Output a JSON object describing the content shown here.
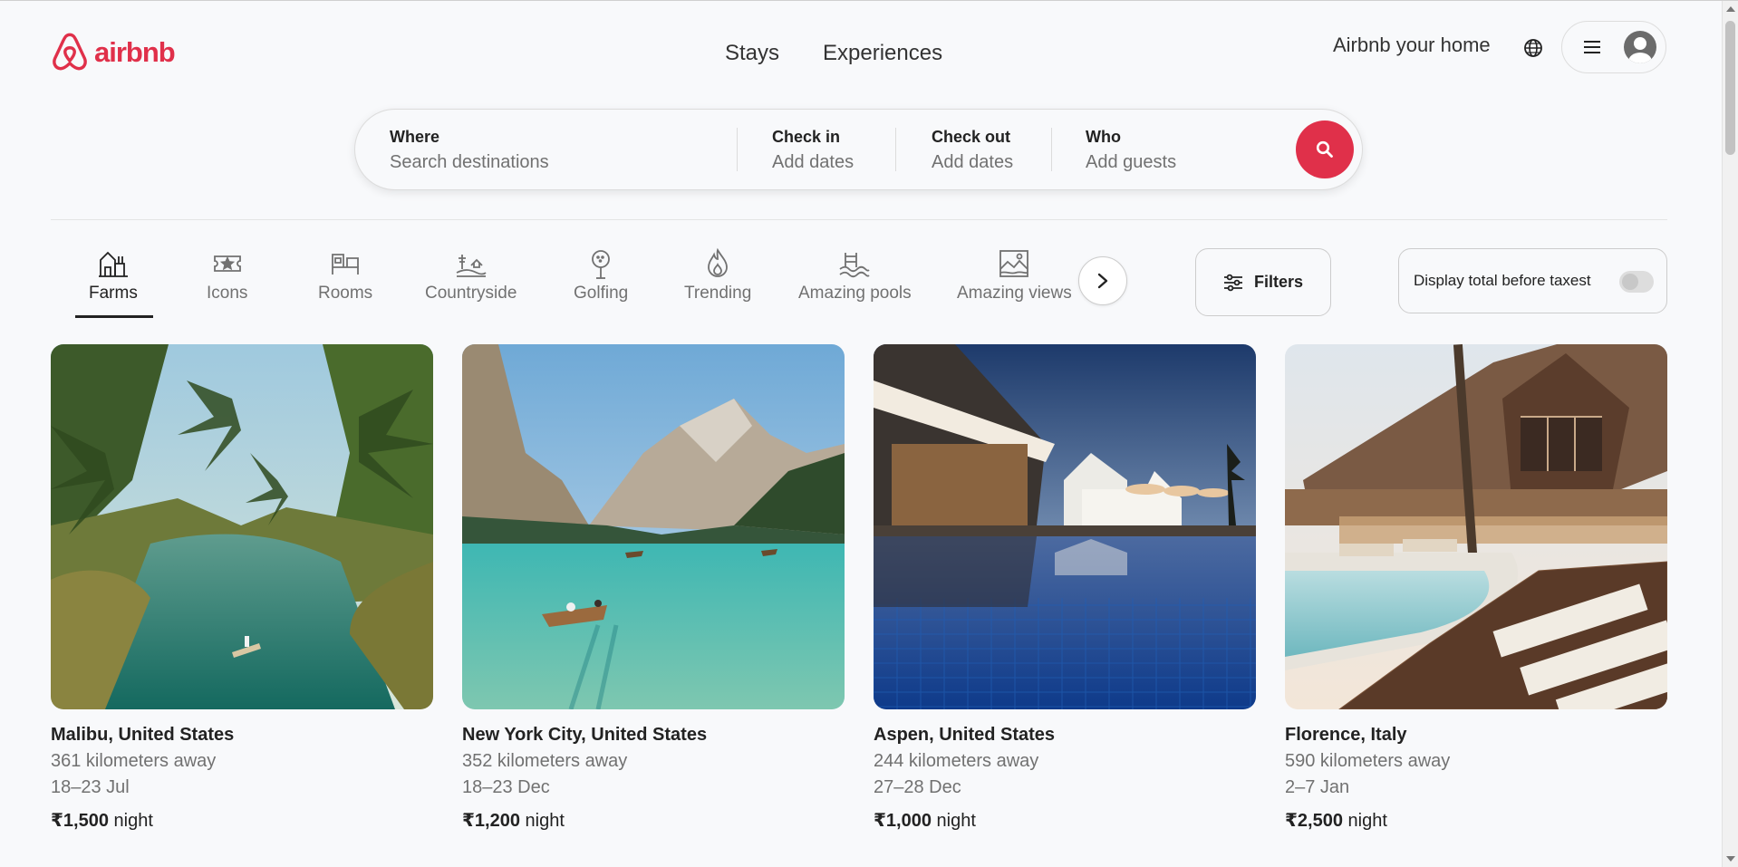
{
  "brand": {
    "name": "airbnb",
    "color": "#e0304a"
  },
  "nav": {
    "stays": "Stays",
    "experiences": "Experiences"
  },
  "header": {
    "host_link": "Airbnb your home",
    "globe_icon": "globe-icon",
    "menu_icon": "menu-icon",
    "avatar_icon": "user-avatar-icon"
  },
  "search": {
    "where_label": "Where",
    "where_placeholder": "Search destinations",
    "checkin_label": "Check in",
    "checkin_value": "Add dates",
    "checkout_label": "Check out",
    "checkout_value": "Add dates",
    "who_label": "Who",
    "who_value": "Add guests",
    "button_icon": "search-icon"
  },
  "categories": [
    {
      "label": "Farms",
      "icon": "farms-icon",
      "active": true
    },
    {
      "label": "Icons",
      "icon": "icons-icon",
      "active": false
    },
    {
      "label": "Rooms",
      "icon": "rooms-icon",
      "active": false
    },
    {
      "label": "Countryside",
      "icon": "countryside-icon",
      "active": false
    },
    {
      "label": "Golfing",
      "icon": "golfing-icon",
      "active": false
    },
    {
      "label": "Trending",
      "icon": "trending-icon",
      "active": false
    },
    {
      "label": "Amazing pools",
      "icon": "amazing-pools-icon",
      "active": false
    },
    {
      "label": "Amazing views",
      "icon": "amazing-views-icon",
      "active": false
    }
  ],
  "filters": {
    "label": "Filters",
    "taxes_label": "Display total before taxest",
    "taxes_toggle_on": false
  },
  "listings": [
    {
      "location": "Malibu, United States",
      "distance": "361 kilometers away",
      "dates": "18–23 Jul",
      "price": "₹1,500",
      "unit": "night",
      "image": "tropical river with palm trees and canoe"
    },
    {
      "location": "New York City, United States",
      "distance": "352 kilometers away",
      "dates": "18–23 Dec",
      "price": "₹1,200",
      "unit": "night",
      "image": "turquoise mountain lake with rowboat"
    },
    {
      "location": "Aspen, United States",
      "distance": "244 kilometers away",
      "dates": "27–28 Dec",
      "price": "₹1,000",
      "unit": "night",
      "image": "resort infinity pool at dusk"
    },
    {
      "location": "Florence, Italy",
      "distance": "590 kilometers away",
      "dates": "2–7 Jan",
      "price": "₹2,500",
      "unit": "night",
      "image": "wooden lodge with pool and loungers"
    }
  ]
}
